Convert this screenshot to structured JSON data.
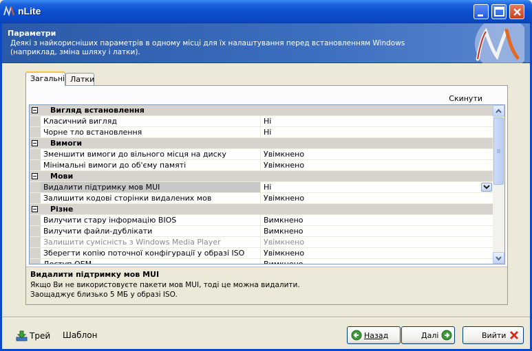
{
  "window": {
    "title": "nLite"
  },
  "header": {
    "title": "Параметри",
    "description": "Деякі з найкорисніших параметрів в одному місці для їх налаштування перед встановленням Windows (наприклад, зміна шляху і латки)."
  },
  "tabs": [
    {
      "label": "Загальні",
      "active": true
    },
    {
      "label": "Латки",
      "active": false
    }
  ],
  "reset_label": "Скинути",
  "grid": {
    "categories": [
      {
        "name": "Вигляд встановлення",
        "items": [
          {
            "name": "Класичний вигляд",
            "value": "Ні"
          },
          {
            "name": "Чорне тло встановлення",
            "value": "Ні"
          }
        ]
      },
      {
        "name": "Вимоги",
        "items": [
          {
            "name": "Зменшити вимоги до вільного місця на диску",
            "value": "Увімкнено"
          },
          {
            "name": "Мінімальні вимоги до об'єму памяті",
            "value": "Увімкнено"
          }
        ]
      },
      {
        "name": "Мови",
        "items": [
          {
            "name": "Видалити підтримку мов MUI",
            "value": "Ні",
            "selected": true
          },
          {
            "name": "Залишити кодові сторінки видалених мов",
            "value": "Увімкнено"
          }
        ]
      },
      {
        "name": "Різне",
        "items": [
          {
            "name": "Вилучити стару інформацію BIOS",
            "value": "Вимкнено"
          },
          {
            "name": "Вилучити файли-дублікати",
            "value": "Вимкнено"
          },
          {
            "name": "Залишити сумісність з Windows Media Player",
            "value": "Увімкнено",
            "disabled": true
          },
          {
            "name": "Зберегти копію поточної конфігурації у образі ISO",
            "value": "Увімкнено"
          },
          {
            "name": "Доступ OEM",
            "value": "Вимкнено"
          }
        ]
      }
    ]
  },
  "help": {
    "title": "Видалити підтримку мов MUI",
    "line1": "Якщо Ви не використовуєте пакети мов MUI, тоді це можна видалити.",
    "line2": "Заощаджує близько 5 МБ у образі ISO."
  },
  "footer": {
    "tray_label": "Трей",
    "template_label": "Шаблон",
    "back_label": "Назад",
    "next_label": "Далі",
    "exit_label": "Вийти"
  }
}
